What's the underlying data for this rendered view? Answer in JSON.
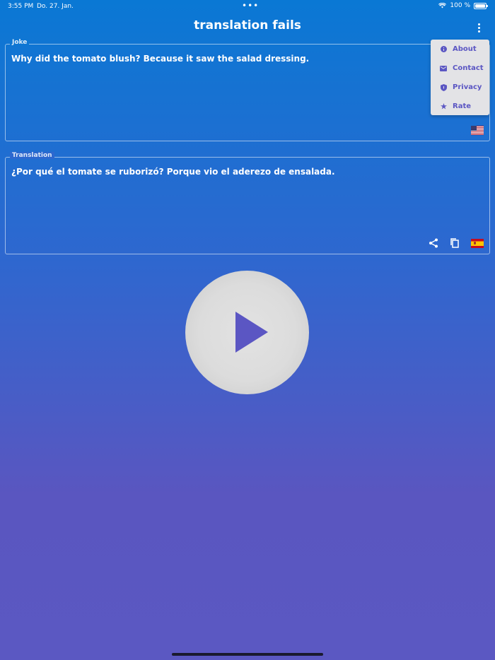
{
  "status_bar": {
    "time": "3:55 PM",
    "date": "Do. 27. Jan.",
    "battery": "100 %",
    "multitask_dots": "•••"
  },
  "app": {
    "title": "translation fails"
  },
  "joke": {
    "legend": "Joke",
    "text": "Why did the tomato blush? Because it saw the salad dressing.",
    "flag": "us-flag-icon"
  },
  "translation": {
    "legend": "Translation",
    "text": "¿Por qué el tomate se ruborizó? Porque vio el aderezo de ensalada.",
    "flag": "es-flag-icon"
  },
  "menu": {
    "items": [
      {
        "label": "About",
        "icon": "info-icon"
      },
      {
        "label": "Contact",
        "icon": "mail-icon"
      },
      {
        "label": "Privacy",
        "icon": "shield-icon"
      },
      {
        "label": "Rate",
        "icon": "star-icon"
      }
    ]
  },
  "colors": {
    "accent": "#5b56c3",
    "gradient_top": "#0a78d4",
    "gradient_bottom": "#5b58c2",
    "menu_bg": "#e3e3e6",
    "play_bg": "#dcdcdc"
  }
}
